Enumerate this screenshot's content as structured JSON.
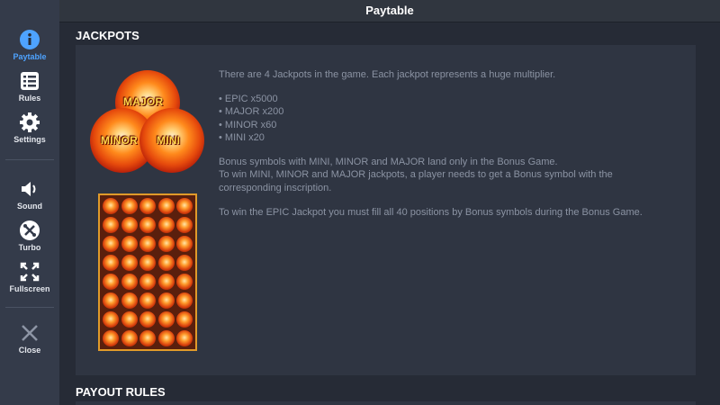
{
  "header": {
    "title": "Paytable"
  },
  "sidebar": {
    "items": [
      {
        "label": "Paytable",
        "icon": "info-icon",
        "active": true
      },
      {
        "label": "Rules",
        "icon": "list-icon"
      },
      {
        "label": "Settings",
        "icon": "gear-icon"
      },
      {
        "label": "Sound",
        "icon": "speaker-icon"
      },
      {
        "label": "Turbo",
        "icon": "tools-icon"
      },
      {
        "label": "Fullscreen",
        "icon": "fullscreen-icon"
      },
      {
        "label": "Close",
        "icon": "close-icon"
      }
    ]
  },
  "jackpots": {
    "section_title": "JACKPOTS",
    "orbs": {
      "major": "MAJOR",
      "minor": "MINOR",
      "mini": "MINI"
    },
    "intro": "There are 4 Jackpots in the game. Each jackpot represents a huge multiplier.",
    "list": [
      "• EPIC x5000",
      "• MAJOR x200",
      "• MINOR x60",
      "• MINI x20"
    ],
    "bonus_line1": "Bonus symbols with MINI, MINOR and MAJOR land only in the Bonus Game.",
    "bonus_line2": "To win MINI, MINOR and MAJOR jackpots, a player needs to get a Bonus symbol with the",
    "bonus_line3": "corresponding inscription.",
    "epic_line": "To win the EPIC Jackpot you must fill all 40 positions by Bonus symbols during the Bonus Game."
  },
  "payout": {
    "section_title": "PAYOUT RULES"
  },
  "colors": {
    "accent": "#4ea3ff",
    "sidebar_bg": "#343b4a",
    "panel_bg": "#2f3542",
    "page_bg": "#262b36"
  }
}
